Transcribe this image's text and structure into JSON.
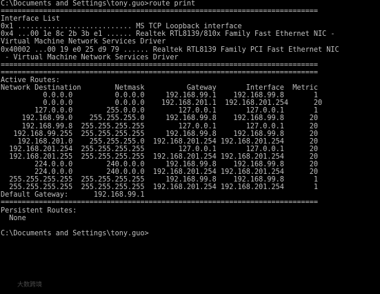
{
  "console": {
    "lines": [
      "C:\\Documents and Settings\\tony.guo>route print",
      "===========================================================================",
      "Interface List",
      "0x1 ........................... MS TCP Loopback interface",
      "0x4 ...00 1e 8c 2b 3b e1 ...... Realtek RTL8139/810x Family Fast Ethernet NIC -",
      "Virtual Machine Network Services Driver",
      "0x40002 ...00 19 e0 25 d9 79 ...... Realtek RTL8139 Family PCI Fast Ethernet NIC",
      " - Virtual Machine Network Services Driver",
      "===========================================================================",
      "===========================================================================",
      "Active Routes:",
      "Network Destination        Netmask          Gateway       Interface  Metric",
      "          0.0.0.0          0.0.0.0     192.168.99.1    192.168.99.8       1",
      "          0.0.0.0          0.0.0.0    192.168.201.1  192.168.201.254      20",
      "        127.0.0.0        255.0.0.0        127.0.0.1       127.0.0.1       1",
      "     192.168.99.0    255.255.255.0     192.168.99.8    192.168.99.8      20",
      "     192.168.99.8  255.255.255.255        127.0.0.1       127.0.0.1      20",
      "   192.168.99.255  255.255.255.255     192.168.99.8    192.168.99.8      20",
      "    192.168.201.0    255.255.255.0  192.168.201.254 192.168.201.254      20",
      "  192.168.201.254  255.255.255.255        127.0.0.1       127.0.0.1      20",
      "  192.168.201.255  255.255.255.255  192.168.201.254 192.168.201.254      20",
      "        224.0.0.0        240.0.0.0     192.168.99.8    192.168.99.8      20",
      "        224.0.0.0        240.0.0.0  192.168.201.254 192.168.201.254      20",
      "  255.255.255.255  255.255.255.255     192.168.99.8    192.168.99.8       1",
      "  255.255.255.255  255.255.255.255  192.168.201.254 192.168.201.254       1",
      "Default Gateway:      192.168.99.1",
      "===========================================================================",
      "Persistent Routes:",
      "  None",
      "",
      "C:\\Documents and Settings\\tony.guo>"
    ]
  },
  "watermark": {
    "text": "大数跨境"
  },
  "colors": {
    "background": "#000000",
    "text": "#c0c0c0"
  }
}
